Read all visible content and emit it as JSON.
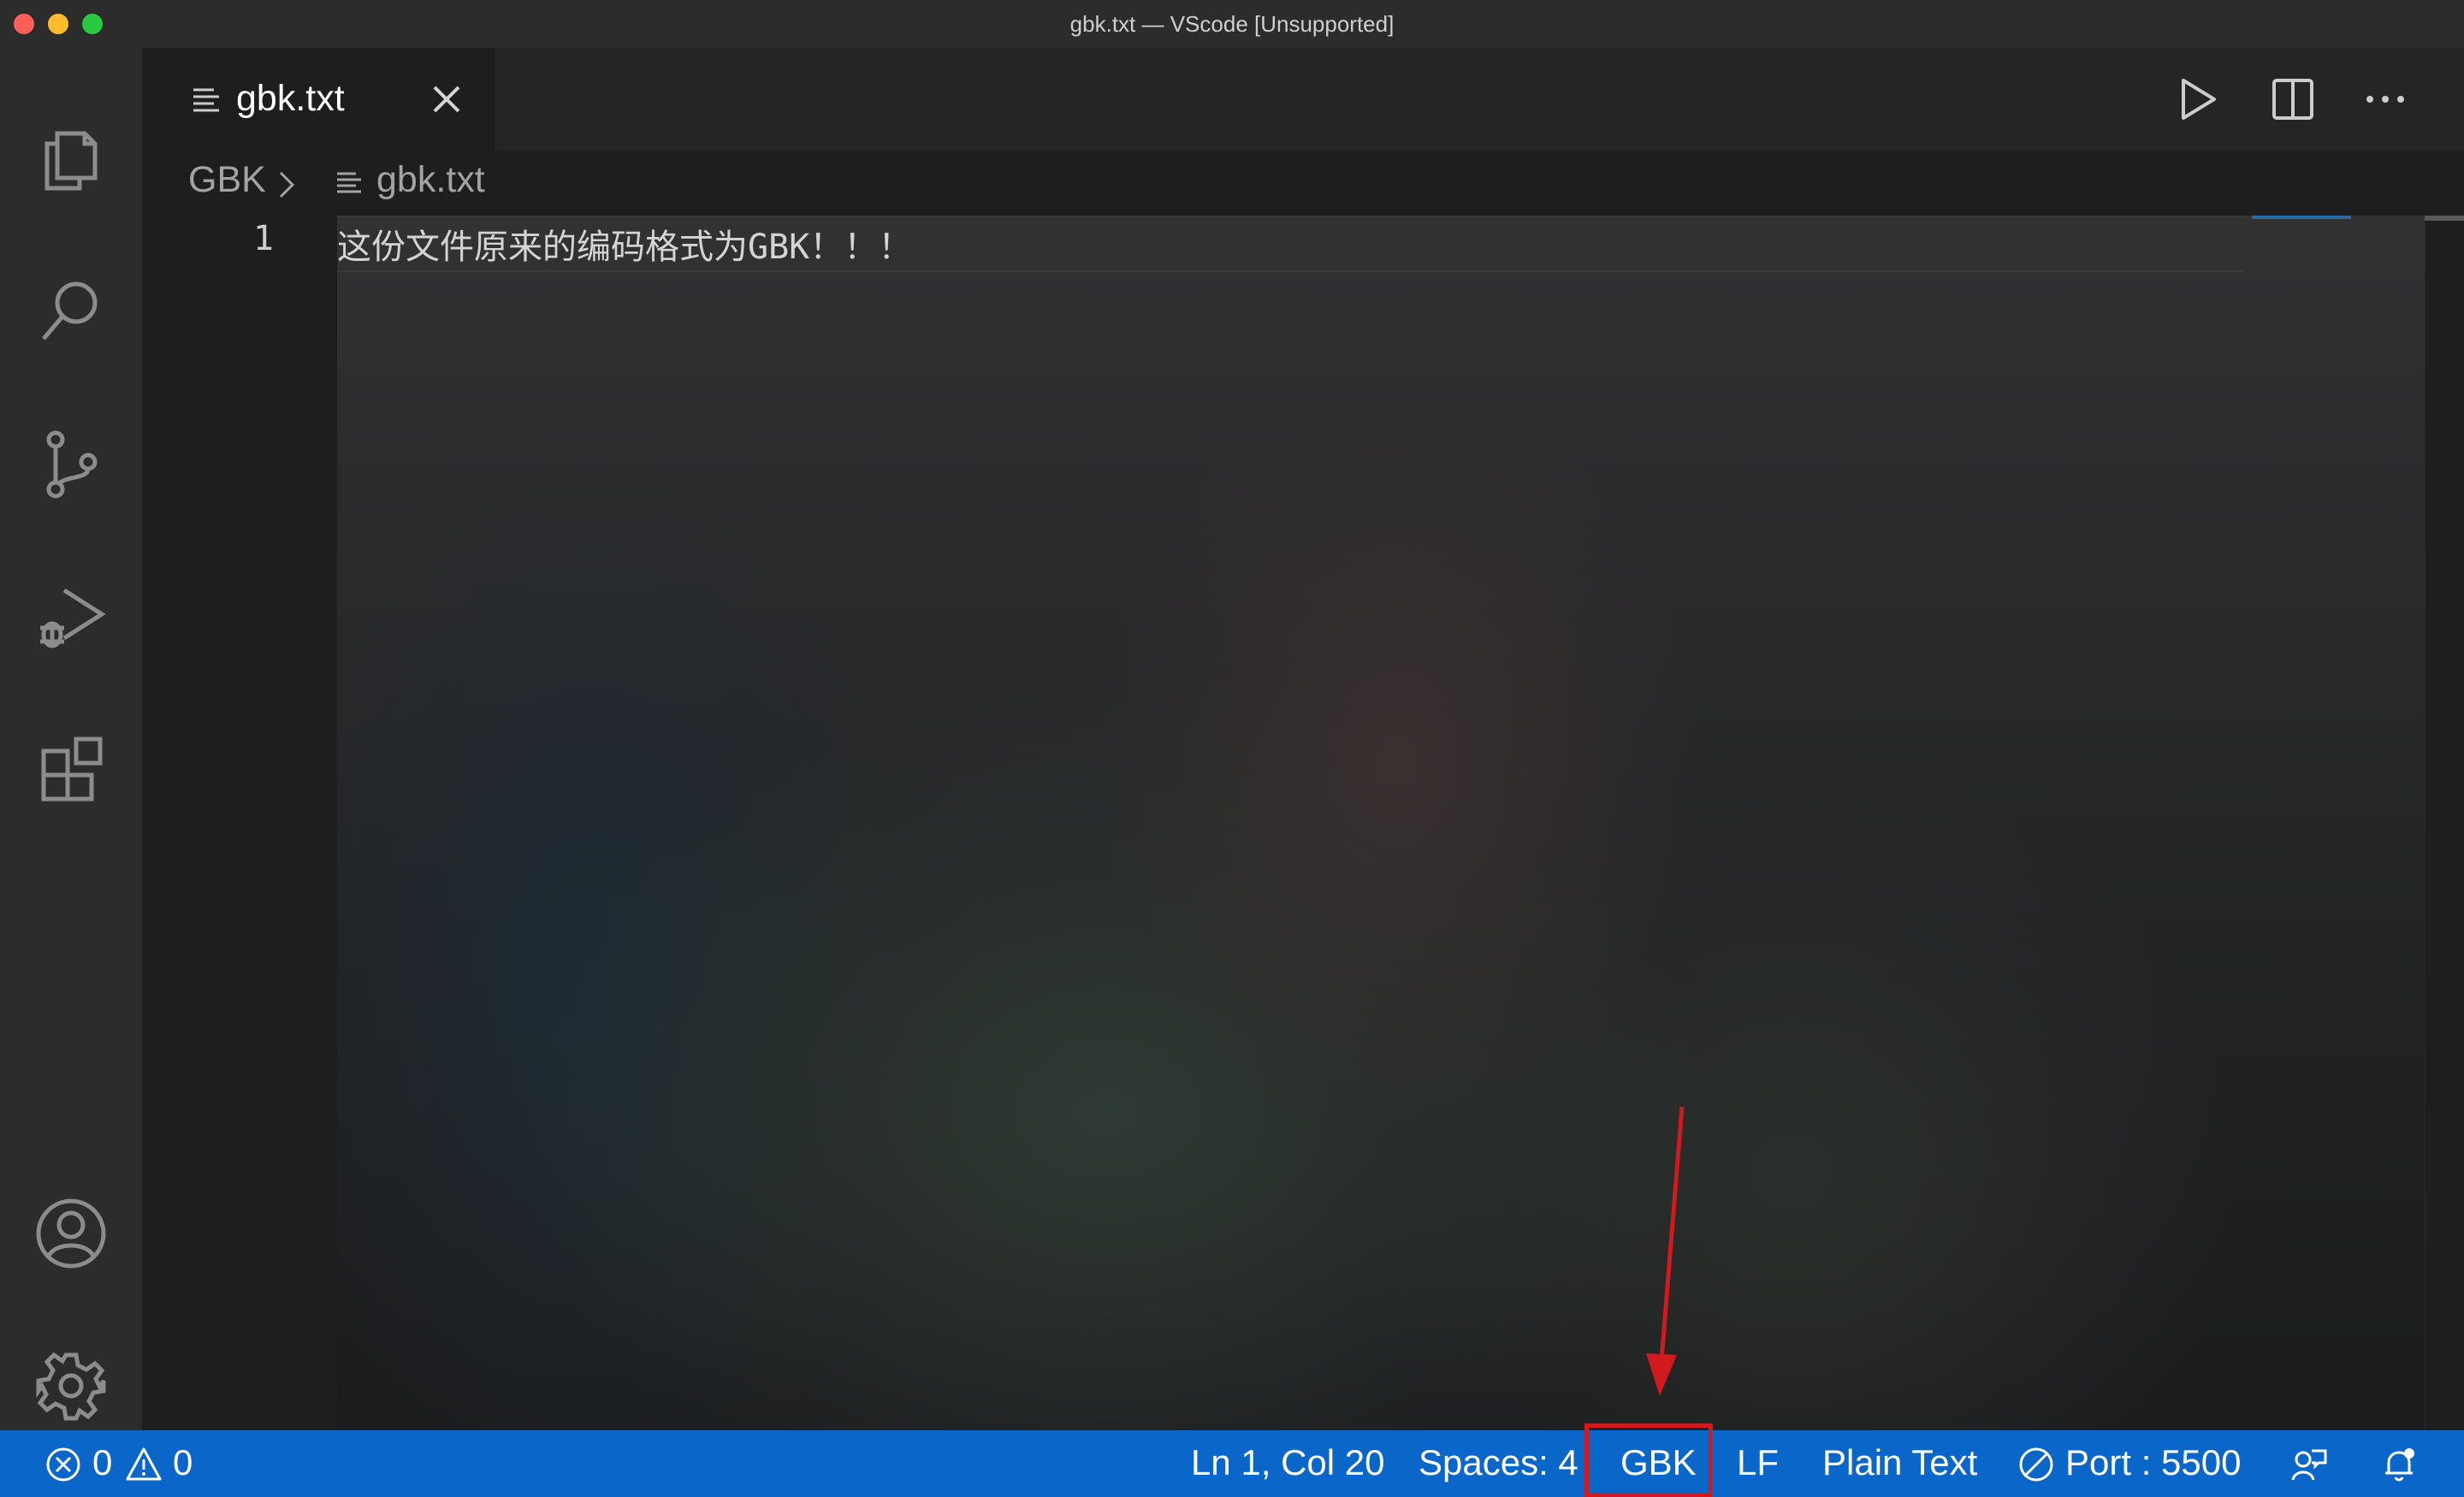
{
  "window": {
    "title": "gbk.txt — VScode [Unsupported]"
  },
  "activity_bar": {
    "items": [
      "explorer-icon",
      "search-icon",
      "source-control-icon",
      "run-debug-icon",
      "extensions-icon"
    ],
    "bottom_items": [
      "account-icon",
      "settings-gear-icon"
    ]
  },
  "tab": {
    "label": "gbk.txt"
  },
  "editor_actions": [
    "run-icon",
    "split-editor-icon",
    "more-actions-icon"
  ],
  "breadcrumb": {
    "root": "GBK",
    "file": "gbk.txt"
  },
  "editor": {
    "line_number": "1",
    "line_text": "这份文件原来的编码格式为GBK！！！"
  },
  "statusbar": {
    "errors": "0",
    "warnings": "0",
    "cursor": "Ln 1, Col 20",
    "indent": "Spaces: 4",
    "encoding": "GBK",
    "eol": "LF",
    "language": "Plain Text",
    "port": "Port : 5500",
    "background_color": "#0a66c8",
    "highlight_color": "#d01a1f"
  }
}
